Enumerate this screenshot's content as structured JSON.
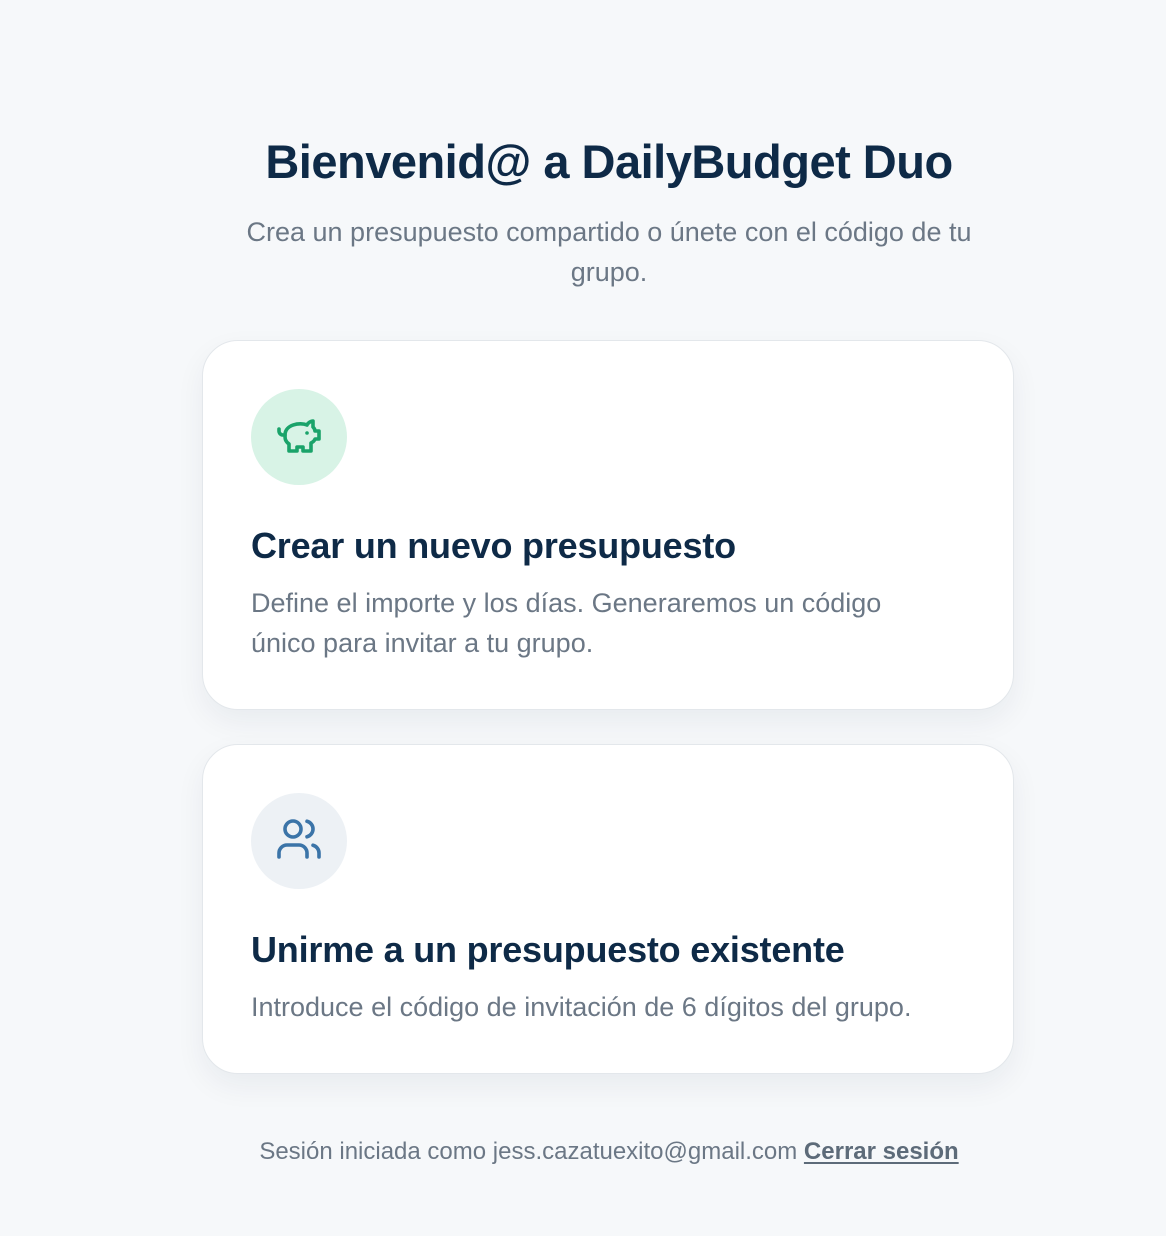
{
  "header": {
    "title": "Bienvenid@ a DailyBudget Duo",
    "subtitle": "Crea un presupuesto compartido o únete con el código de tu grupo."
  },
  "options": [
    {
      "icon": "piggy-bank-icon",
      "title": "Crear un nuevo presupuesto",
      "description": "Define el importe y los días. Generaremos un código único para invitar a tu grupo."
    },
    {
      "icon": "users-icon",
      "title": "Unirme a un presupuesto existente",
      "description": "Introduce el código de invitación de 6 dígitos del grupo."
    }
  ],
  "footer": {
    "session_text": "Sesión iniciada como jess.cazatuexito@gmail.com",
    "logout_label": "Cerrar sesión"
  },
  "colors": {
    "background": "#f6f8fa",
    "heading": "#0e2a47",
    "muted_text": "#6b7785",
    "green_icon": "#1aa36a",
    "green_icon_bg": "#d8f3e6",
    "blue_icon": "#3b74a8",
    "blue_icon_bg": "#edf1f5"
  }
}
